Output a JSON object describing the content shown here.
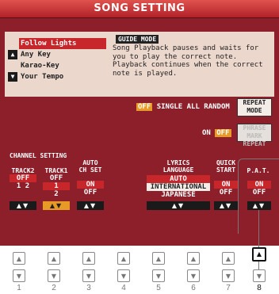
{
  "title": "SONG SETTING",
  "mode_list": {
    "up_arrow": "▲",
    "down_arrow": "▼",
    "items": [
      "Follow Lights",
      "Any Key",
      "Karao-Key",
      "Your Tempo"
    ]
  },
  "guide": {
    "tag": "GUIDE MODE",
    "description": "Song Playback pauses and waits for you to play the correct note. Playback continues when the correct note is played."
  },
  "repeat": {
    "off_tag": "OFF",
    "options": "SINGLE ALL RANDOM",
    "repeat_mode_line1": "REPEAT",
    "repeat_mode_line2": "MODE",
    "on_label": "ON",
    "off_tag2": "OFF",
    "phrase_line1": "PHRASE MARK",
    "phrase_line2": "REPEAT"
  },
  "channel": {
    "heading": "CHANNEL SETTING",
    "track2": {
      "label": "TRACK2",
      "value1": "OFF",
      "value2": "1",
      "value3": "2"
    },
    "track1": {
      "label": "TRACK1",
      "value1": "OFF",
      "value2": "1",
      "value3": "2"
    },
    "auto_ch": {
      "label1": "AUTO",
      "label2": "CH SET",
      "on": "ON",
      "off": "OFF"
    }
  },
  "lyrics": {
    "label1": "LYRICS",
    "label2": "LANGUAGE",
    "auto": "AUTO",
    "intl": "INTERNATIONAL",
    "jp": "JAPANESE"
  },
  "quick_start": {
    "label1": "QUICK",
    "label2": "START",
    "on": "ON",
    "off": "OFF"
  },
  "pat": {
    "label": "P.A.T.",
    "on": "ON",
    "off": "OFF"
  },
  "arrows": "▲▼",
  "hw_up": "▲",
  "hw_down": "▼",
  "numbers": [
    "1",
    "2",
    "3",
    "4",
    "5",
    "6",
    "7",
    "8"
  ]
}
